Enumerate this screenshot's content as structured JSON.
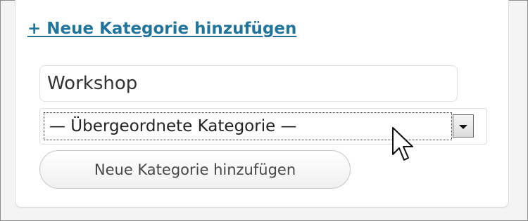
{
  "category_box": {
    "add_link_label": "+ Neue Kategorie hinzufügen",
    "name_input_value": "Workshop",
    "parent_select_value": "— Übergeordnete Kategorie —",
    "submit_label": "Neue Kategorie hinzufügen"
  },
  "colors": {
    "link": "#21759b",
    "border": "#dfdfdf",
    "text": "#333333"
  },
  "icons": {
    "dropdown": "chevron-down-icon",
    "pointer": "mouse-cursor-icon"
  }
}
